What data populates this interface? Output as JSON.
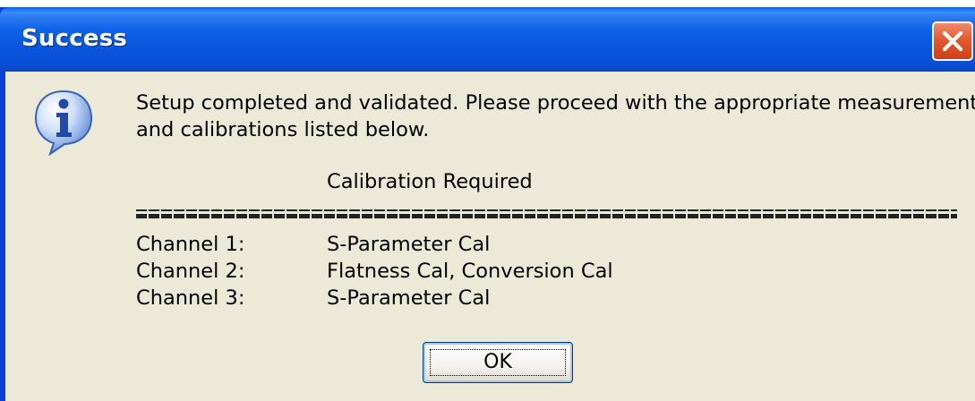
{
  "window": {
    "title": "Success",
    "close_icon": "close-x-icon"
  },
  "dialog": {
    "icon": "info-icon",
    "message_line1": "Setup completed and validated.  Please proceed with the appropriate measurement(s)",
    "message_line2": "and calibrations listed below.",
    "calibration_header": "Calibration Required",
    "separator": "=================================================",
    "rows": [
      {
        "channel": "Channel 1:",
        "calibration": "S-Parameter Cal"
      },
      {
        "channel": "Channel 2:",
        "calibration": "Flatness Cal, Conversion Cal"
      },
      {
        "channel": "Channel 3:",
        "calibration": "S-Parameter Cal"
      }
    ],
    "ok_label": "OK"
  },
  "colors": {
    "titlebar": "#0a55dc",
    "dialog_bg": "#ece9d8",
    "close_button": "#e25a32"
  }
}
